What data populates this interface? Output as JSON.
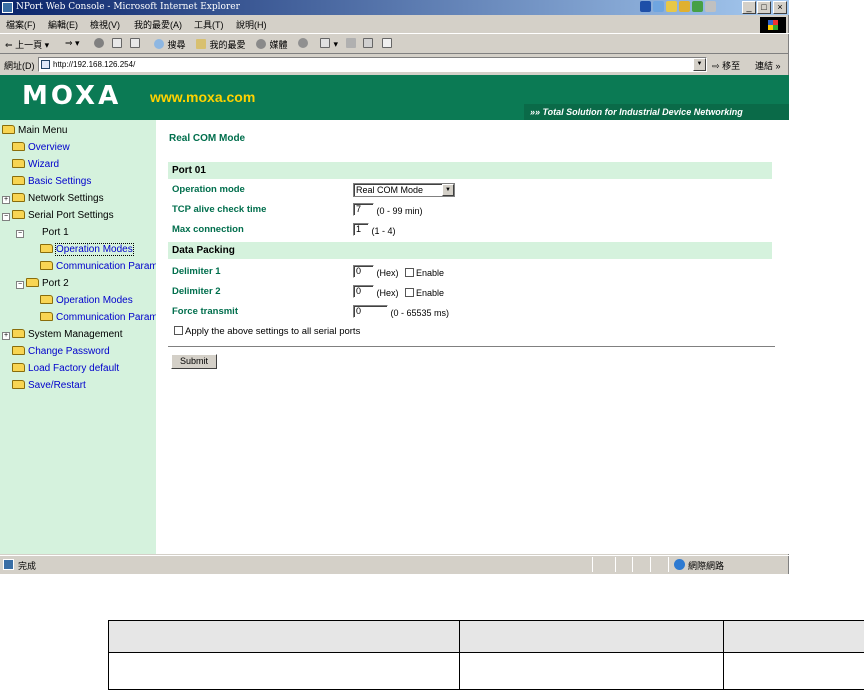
{
  "window": {
    "title": "NPort Web Console - Microsoft Internet Explorer",
    "buttons": {
      "minimize": "_",
      "maximize": "□",
      "close": "×"
    }
  },
  "menu": [
    "檔案(F)",
    "編輯(E)",
    "檢視(V)",
    "我的最愛(A)",
    "工具(T)",
    "說明(H)"
  ],
  "toolbar": {
    "back": "上一頁",
    "search": "搜尋",
    "favorites": "我的最愛",
    "media": "媒體"
  },
  "address": {
    "label": "網址(D)",
    "url": "http://192.168.126.254/",
    "go": "移至",
    "links": "連結 »"
  },
  "banner": {
    "brand": "MOXA",
    "url": "www.moxa.com",
    "tagline": "Total Solution for Industrial Device Networking"
  },
  "nav": {
    "main_menu": "Main Menu",
    "overview": "Overview",
    "wizard": "Wizard",
    "basic_settings": "Basic Settings",
    "network_settings": "Network Settings",
    "serial_port_settings": "Serial Port Settings",
    "port1": "Port 1",
    "operation_modes": "Operation Modes",
    "communication_parameters": "Communication Parameters",
    "port2": "Port 2",
    "system_management": "System Management",
    "change_password": "Change Password",
    "load_factory_default": "Load Factory default",
    "save_restart": "Save/Restart"
  },
  "form": {
    "title": "Real COM Mode",
    "port_header": "Port 01",
    "operation_mode": {
      "label": "Operation mode",
      "value": "Real COM Mode"
    },
    "tcp_alive": {
      "label": "TCP alive check time",
      "value": "7",
      "hint": "(0 - 99 min)"
    },
    "max_connection": {
      "label": "Max connection",
      "value": "1",
      "hint": "(1 - 4)"
    },
    "data_packing_header": "Data Packing",
    "delimiter1": {
      "label": "Delimiter 1",
      "value": "0",
      "unit": "(Hex)",
      "enable": "Enable"
    },
    "delimiter2": {
      "label": "Delimiter 2",
      "value": "0",
      "unit": "(Hex)",
      "enable": "Enable"
    },
    "force_transmit": {
      "label": "Force transmit",
      "value": "0",
      "hint": "(0 - 65535 ms)"
    },
    "apply_all": "Apply the above settings to all serial ports",
    "submit": "Submit"
  },
  "status": {
    "text": "完成",
    "zone": "網際網路"
  }
}
